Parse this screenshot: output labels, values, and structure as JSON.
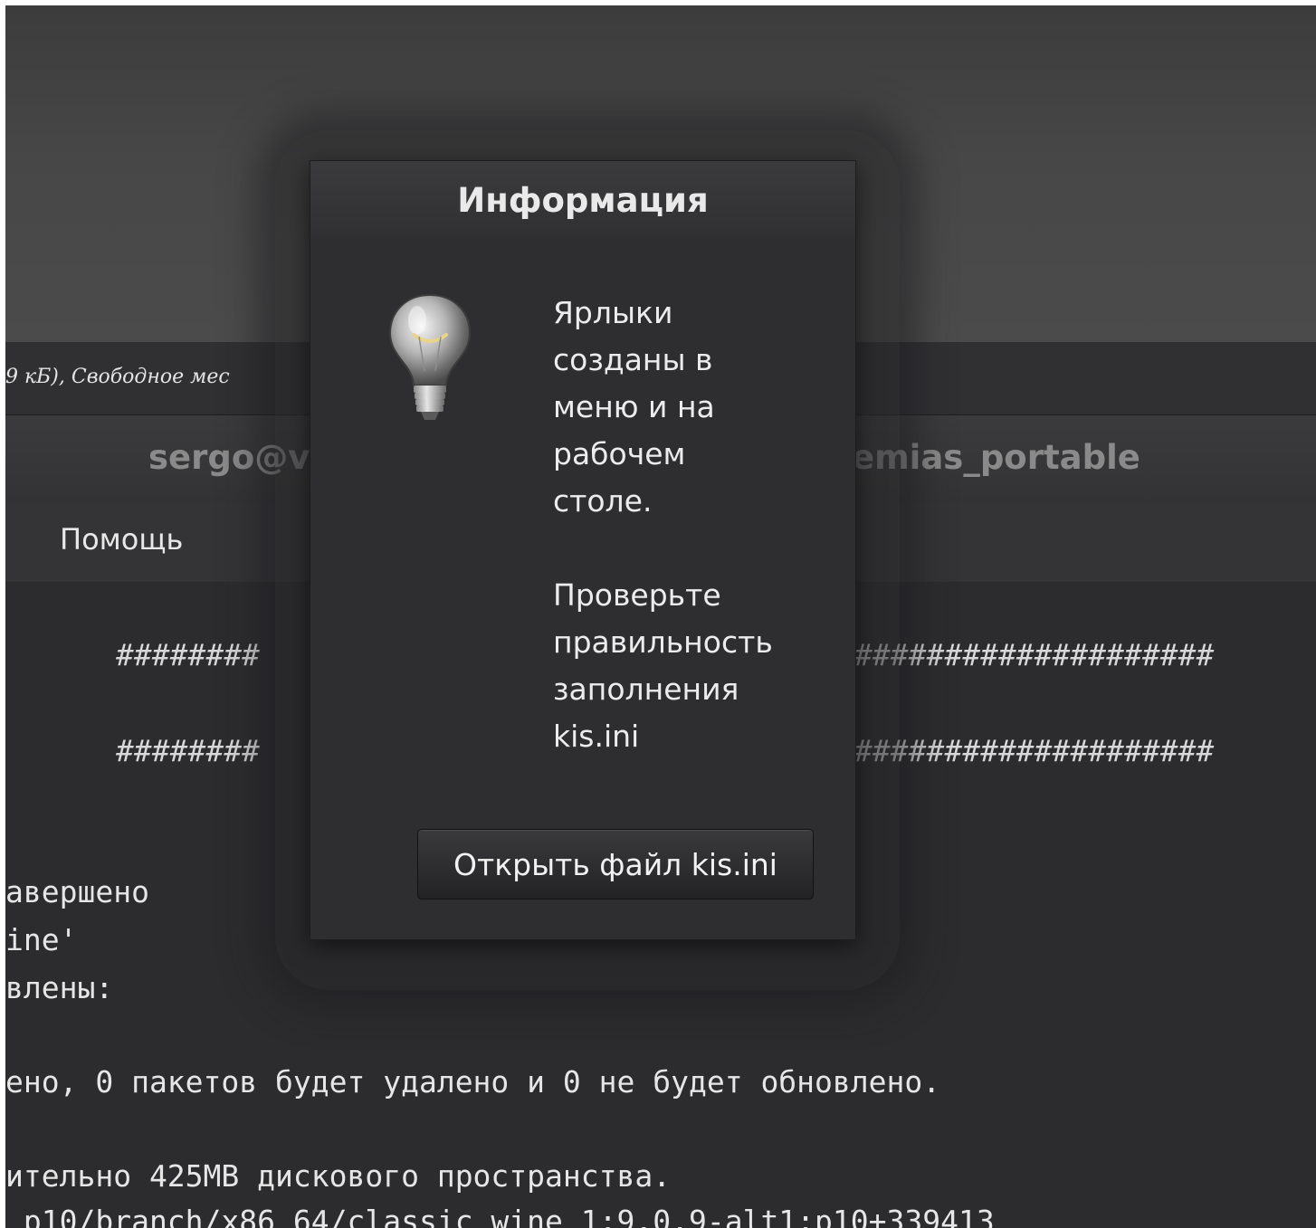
{
  "background": {
    "status_text": "9 кБ), Свободное мес",
    "terminal_title_left": "sergo@v",
    "terminal_title_right": "emias_portable",
    "menu_help": "Помощь",
    "hash_left": "########",
    "hash_right": "####################",
    "lines": [
      "авершено",
      "ine'",
      "влены:",
      "ено, 0 пакетов будет удалено и 0 не будет обновлено.",
      "ительно 425MB дискового пространства.",
      " p10/branch/x86_64/classic wine 1:9.0.9-alt1:p10+339413"
    ]
  },
  "dialog": {
    "title": "Информация",
    "icon": "lightbulb-icon",
    "message_lines_1": [
      "Ярлыки",
      "созданы в",
      "меню и на",
      "рабочем",
      "столе."
    ],
    "message_lines_2": [
      "Проверьте",
      "правильность",
      "заполнения",
      "kis.ini"
    ],
    "button_label": "Открыть файл kis.ini"
  }
}
